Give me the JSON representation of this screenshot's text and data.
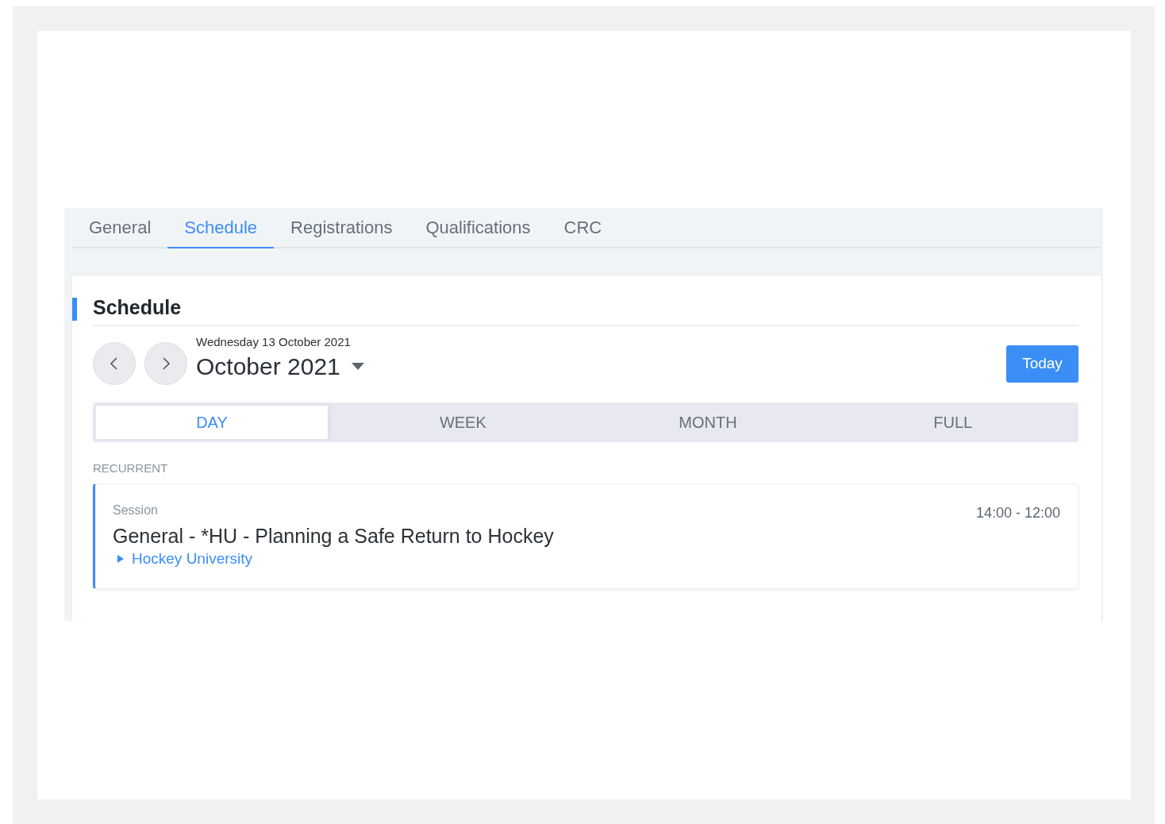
{
  "tabs": [
    {
      "label": "General",
      "selected": false
    },
    {
      "label": "Schedule",
      "selected": true
    },
    {
      "label": "Registrations",
      "selected": false
    },
    {
      "label": "Qualifications",
      "selected": false
    },
    {
      "label": "CRC",
      "selected": false
    }
  ],
  "section": {
    "title": "Schedule"
  },
  "date_nav": {
    "current_date": "Wednesday 13 October 2021",
    "month": "October 2021",
    "today_button": "Today"
  },
  "view_modes": [
    {
      "label": "DAY",
      "selected": true
    },
    {
      "label": "WEEK",
      "selected": false
    },
    {
      "label": "MONTH",
      "selected": false
    },
    {
      "label": "FULL",
      "selected": false
    }
  ],
  "groups": [
    {
      "heading": "RECURRENT",
      "events": [
        {
          "type": "Session",
          "title": "General - *HU - Planning a Safe Return to Hockey",
          "time": "14:00 - 12:00",
          "link": "Hockey University"
        }
      ]
    }
  ]
}
